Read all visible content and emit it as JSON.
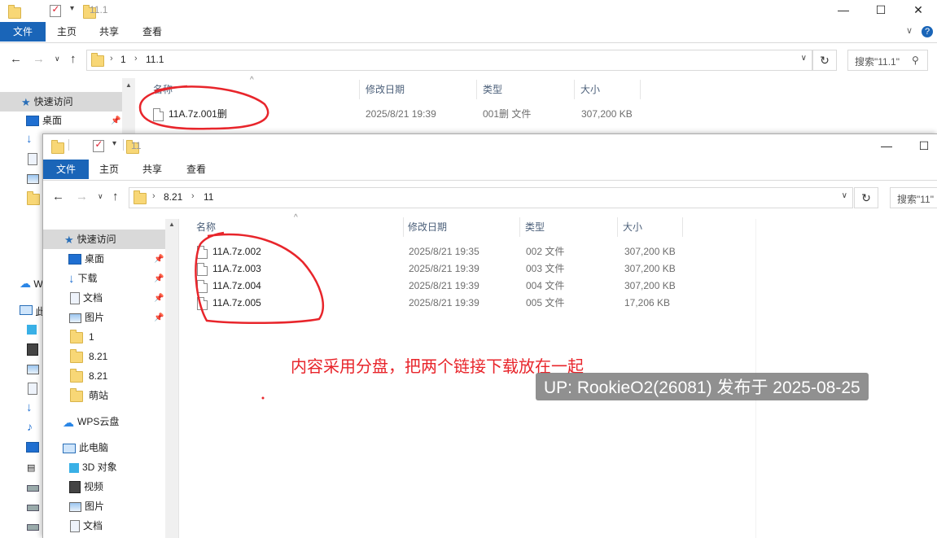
{
  "back_window": {
    "title": "11.1",
    "ribbon": {
      "file": "文件",
      "tabs": [
        "主页",
        "共享",
        "查看"
      ]
    },
    "breadcrumb": [
      "1",
      "11.1"
    ],
    "search_placeholder": "搜索\"11.1\"",
    "columns": [
      "名称",
      "修改日期",
      "类型",
      "大小"
    ],
    "files": [
      {
        "name": "11A.7z.001删",
        "date": "2025/8/21 19:39",
        "type": "001删 文件",
        "size": "307,200 KB"
      }
    ],
    "sidebar": {
      "quick_access": "快速访问",
      "desktop": "桌面",
      "wps": "W",
      "pc": "此"
    }
  },
  "front_window": {
    "title": "11",
    "ribbon": {
      "file": "文件",
      "tabs": [
        "主页",
        "共享",
        "查看"
      ]
    },
    "breadcrumb": [
      "8.21",
      "11"
    ],
    "search_placeholder": "搜索\"11\"",
    "columns": [
      "名称",
      "修改日期",
      "类型",
      "大小"
    ],
    "files": [
      {
        "name": "11A.7z.002",
        "date": "2025/8/21 19:35",
        "type": "002 文件",
        "size": "307,200 KB"
      },
      {
        "name": "11A.7z.003",
        "date": "2025/8/21 19:39",
        "type": "003 文件",
        "size": "307,200 KB"
      },
      {
        "name": "11A.7z.004",
        "date": "2025/8/21 19:39",
        "type": "004 文件",
        "size": "307,200 KB"
      },
      {
        "name": "11A.7z.005",
        "date": "2025/8/21 19:39",
        "type": "005 文件",
        "size": "17,206 KB"
      }
    ],
    "sidebar": [
      "快速访问",
      "桌面",
      "下载",
      "文档",
      "图片",
      "1",
      "8.21",
      "8.21",
      "萌站",
      "WPS云盘",
      "此电脑",
      "3D 对象",
      "视频",
      "图片",
      "文档"
    ]
  },
  "annotation": "内容采用分盘，把两个链接下载放在一起",
  "watermark": "UP: RookieO2(26081) 发布于 2025-08-25",
  "colors": {
    "accent": "#1a65b8",
    "annotation": "#e8252b",
    "folder": "#f8d776"
  }
}
